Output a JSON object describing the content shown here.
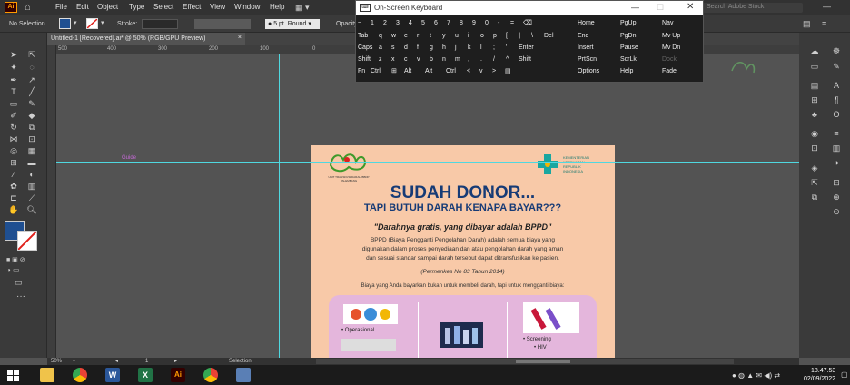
{
  "menubar": {
    "app_logo": "Ai",
    "items": [
      "File",
      "Edit",
      "Object",
      "Type",
      "Select",
      "Effect",
      "View",
      "Window",
      "Help"
    ],
    "search_placeholder": "Search Adobe Stock"
  },
  "options_bar": {
    "selection_label": "No Selection",
    "stroke_label": "Stroke:",
    "brush_label": "5 pt. Round",
    "opacity_label": "Opacity"
  },
  "document_tab": {
    "title": "Untitled-1 [Recovered].ai* @ 50% (RGB/GPU Preview)",
    "close": "×"
  },
  "ruler_labels": [
    "500",
    "400",
    "300",
    "200",
    "100",
    "0"
  ],
  "guide_label": "Guide",
  "artboard": {
    "org_name": "UNIT TRANSFUSI DARAH BBDP PALEMBANG",
    "ministry": "KEMENTERIAN KESEHATAN REPUBLIK INDONESIA",
    "headline": "SUDAH DONOR...",
    "subheadline": "TAPI BUTUH DARAH KENAPA BAYAR???",
    "quote": "\"Darahnya gratis, yang dibayar adalah BPPD\"",
    "body": "BPPD (Biaya Pengganti Pengolahan Darah) adalah semua biaya yang digunakan dalam proses penyediaan dan atau pengolahan darah yang aman dan sesuai standar sampai darah tersebut dapat ditransfusikan ke pasien.",
    "citation": "(Permenkes No 83 Tahun 2014)",
    "intro": "Biaya yang Anda bayarkan bukan untuk membeli darah, tapi untuk mengganti biaya:",
    "items": [
      "Operasional",
      "Screening",
      "HIV"
    ]
  },
  "osk": {
    "title": "On-Screen Keyboard",
    "rows": [
      [
        "~",
        "1",
        "2",
        "3",
        "4",
        "5",
        "6",
        "7",
        "8",
        "9",
        "0",
        "-",
        "=",
        "⌫"
      ],
      [
        "Tab",
        "q",
        "w",
        "e",
        "r",
        "t",
        "y",
        "u",
        "i",
        "o",
        "p",
        "[",
        "]",
        "\\",
        "Del"
      ],
      [
        "Caps",
        "a",
        "s",
        "d",
        "f",
        "g",
        "h",
        "j",
        "k",
        "l",
        ";",
        "'",
        "Enter"
      ],
      [
        "Shift",
        "z",
        "x",
        "c",
        "v",
        "b",
        "n",
        "m",
        ",",
        ".",
        "/",
        "^",
        "Shift"
      ],
      [
        "Fn",
        "Ctrl",
        "⊞",
        "Alt",
        "Alt",
        "Ctrl",
        "<",
        "v",
        ">",
        "▤"
      ]
    ],
    "nav_keys": [
      [
        "Home",
        "PgUp",
        "Nav"
      ],
      [
        "End",
        "PgDn",
        "Mv Up"
      ],
      [
        "Insert",
        "Pause",
        "Mv Dn"
      ],
      [
        "PrtScn",
        "ScrLk",
        "Dock"
      ],
      [
        "Options",
        "Help",
        "Fade"
      ]
    ]
  },
  "statusbar": {
    "zoom": "50%",
    "artboard_num": "1",
    "tool": "Selection"
  },
  "taskbar": {
    "time": "18.47.53",
    "date": "02/09/2022"
  },
  "colors": {
    "accent_blue": "#1f4f91",
    "artboard_bg": "#f8c9a8",
    "guide": "#4fd8e0",
    "headline": "#173b76"
  }
}
